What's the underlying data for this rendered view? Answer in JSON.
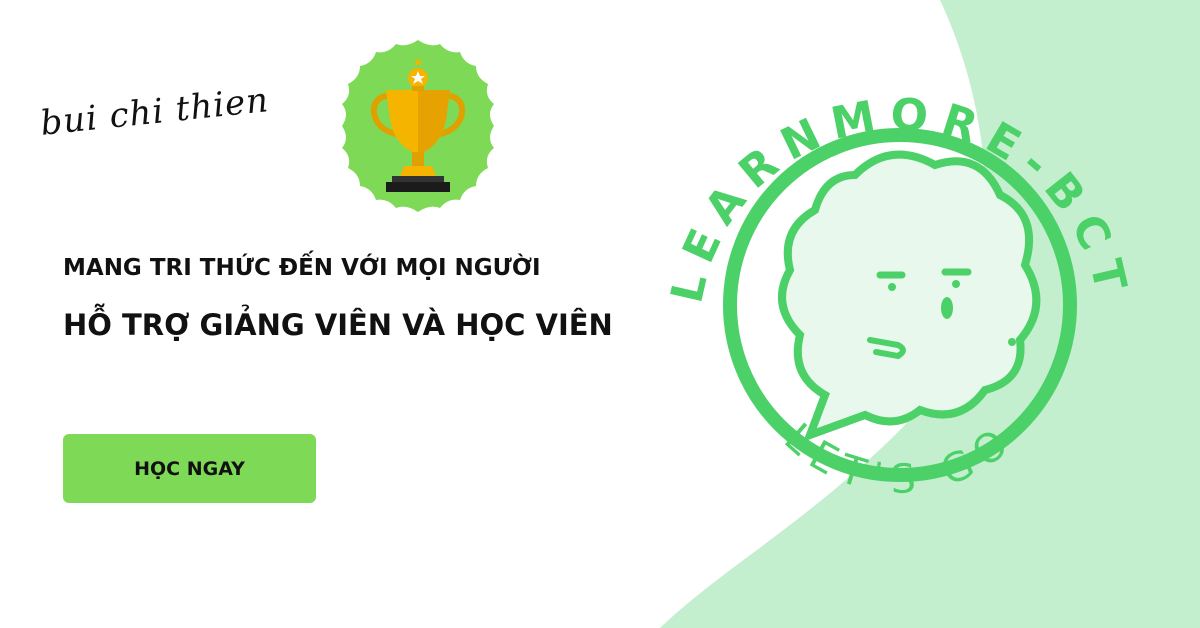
{
  "brand": {
    "signature": "bui chi thien"
  },
  "hero": {
    "tagline_1": "MANG TRI THỨC ĐẾN VỚI MỌI NGƯỜI",
    "tagline_2": "HỖ TRỢ GIẢNG VIÊN VÀ HỌC VIÊN",
    "cta_label": "HỌC NGAY"
  },
  "logo": {
    "arc_top": "LEARNMORE-BCT",
    "arc_bottom": "LET'S GO"
  },
  "colors": {
    "accent_green": "#7ed957",
    "logo_green": "#4cd168",
    "mint_bg": "#c3efcf",
    "trophy_gold": "#f5b400"
  },
  "icons": [
    "trophy-icon",
    "star-icon",
    "speech-bubble-icon"
  ]
}
